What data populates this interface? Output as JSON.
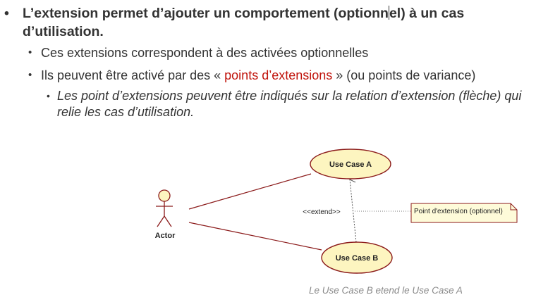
{
  "slide": {
    "bullet1": {
      "marker": "•",
      "text_before_cursor": "L’extension permet d’ajouter un comportement (optionn",
      "text_after_cursor": "el) à un cas d’utilisation."
    },
    "bullet2a": {
      "marker": "•",
      "text": "Ces extensions correspondent à des activées optionnelles"
    },
    "bullet2b": {
      "marker": "•",
      "text_before": "Ils peuvent être activé par des « ",
      "highlight": "points d’extensions",
      "text_after": " » (ou points de variance)"
    },
    "bullet3": {
      "marker": "•",
      "text": "Les point d’extensions peuvent être indiqués sur la relation d’extension (flèche) qui relie les cas d’utilisation."
    }
  },
  "diagram": {
    "actor_label": "Actor",
    "use_case_a": "Use Case A",
    "use_case_b": "Use Case B",
    "extend_label": "<<extend>>",
    "note_text": "Point d'extension (optionnel)",
    "caption": "Le Use Case B etend le Use Case A",
    "colors": {
      "use_case_fill": "#fdf5c0",
      "use_case_stroke": "#8b1a1a",
      "note_fill": "#fefbd9",
      "line": "#8b1a1a",
      "highlight_text": "#c0140c"
    }
  }
}
